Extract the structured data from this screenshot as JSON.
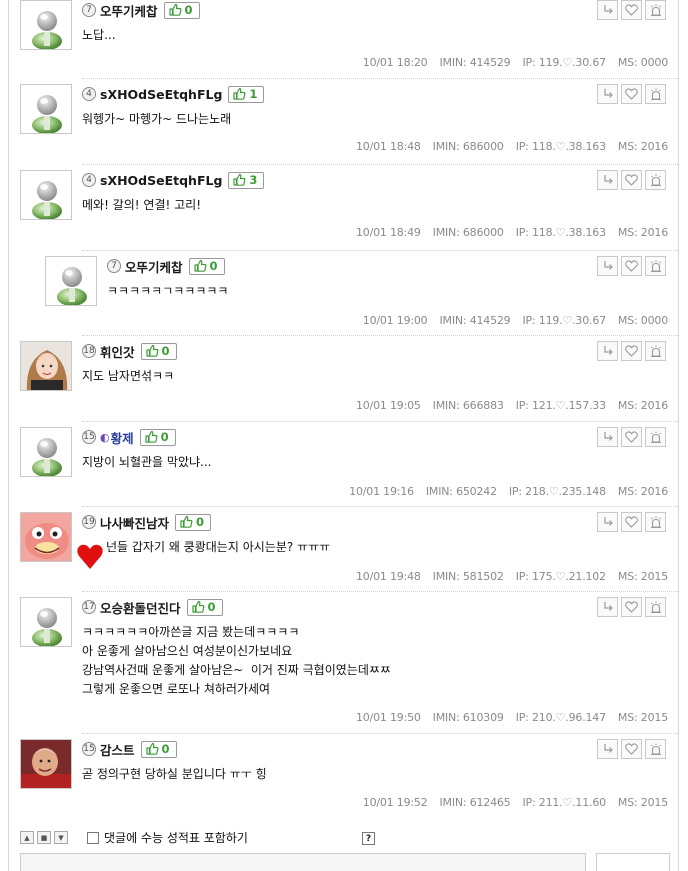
{
  "comments": [
    {
      "level": "7",
      "nick": "오뚜기케찹",
      "likes": "0",
      "lines": [
        "노답..."
      ],
      "date": "10/01 18:20",
      "imin": "IMIN: 414529",
      "ip": "IP: 119.♡.30.67",
      "ms": "MS: 0000",
      "avatar": "default"
    },
    {
      "level": "4",
      "nick": "sXHOdSeEtqhFLg",
      "likes": "1",
      "lines": [
        "워헹가~ 마헹가~ 드나는노래"
      ],
      "date": "10/01 18:48",
      "imin": "IMIN: 686000",
      "ip": "IP: 118.♡.38.163",
      "ms": "MS: 2016",
      "avatar": "default"
    },
    {
      "level": "4",
      "nick": "sXHOdSeEtqhFLg",
      "likes": "3",
      "lines": [
        "메와! 갈의! 연결! 고리!"
      ],
      "date": "10/01 18:49",
      "imin": "IMIN: 686000",
      "ip": "IP: 118.♡.38.163",
      "ms": "MS: 2016",
      "avatar": "default"
    },
    {
      "level": "7",
      "nick": "오뚜기케찹",
      "likes": "0",
      "lines": [
        "ㅋㅋㅋㅋㅋㄱㅋㅋㅋㅋㅋ"
      ],
      "date": "10/01 19:00",
      "imin": "IMIN: 414529",
      "ip": "IP: 119.♡.30.67",
      "ms": "MS: 0000",
      "avatar": "default",
      "reply": true
    },
    {
      "level": "18",
      "nick": "휘인갓",
      "likes": "0",
      "lines": [
        "지도 남자면섞ㅋㅋ"
      ],
      "date": "10/01 19:05",
      "imin": "IMIN: 666883",
      "ip": "IP: 121.♡.157.33",
      "ms": "MS: 2016",
      "avatar": "girl"
    },
    {
      "level": "15",
      "nick": "황제",
      "likes": "0",
      "lines": [
        "지방이 뇌혈관을 막았냐..."
      ],
      "date": "10/01 19:16",
      "imin": "IMIN: 650242",
      "ip": "IP: 218.♡.235.148",
      "ms": "MS: 2016",
      "avatar": "default",
      "badge": true
    },
    {
      "level": "19",
      "nick": "나사빠진남자",
      "likes": "0",
      "lines": [
        "넌들 갑자기 왜 쿵쾅대는지 아시는분? ㅠㅠㅠ"
      ],
      "date": "10/01 19:48",
      "imin": "IMIN: 581502",
      "ip": "IP: 175.♡.21.102",
      "ms": "MS: 2015",
      "avatar": "pink",
      "heart": true
    },
    {
      "level": "17",
      "nick": "오승환돌던진다",
      "likes": "0",
      "lines": [
        "ㅋㅋㅋㅋㅋㅋ아까쓴글 지금 봤는데ㅋㅋㅋㅋ",
        "아 운좋게 살아남으신 여성분이신가보네요",
        "강남역사건때 운좋게 살아남은~  이거 진짜 극협이였는데ㅉㅉ",
        "그렇게 운좋으면 로또나 쳐하러가세여"
      ],
      "date": "10/01 19:50",
      "imin": "IMIN: 610309",
      "ip": "IP: 210.♡.96.147",
      "ms": "MS: 2015",
      "avatar": "default"
    },
    {
      "level": "15",
      "nick": "감스트",
      "likes": "0",
      "lines": [
        "곧 정의구현 당하실 분입니다 ㅠㅜ 힝"
      ],
      "date": "10/01 19:52",
      "imin": "IMIN: 612465",
      "ip": "IP: 211.♡.11.60",
      "ms": "MS: 2015",
      "avatar": "man"
    }
  ],
  "footer": {
    "include_label": "댓글에 수능 성적표 포함하기",
    "help": "?"
  },
  "icons": {
    "reply": "reply-arrow-icon",
    "like": "heart-icon",
    "report": "siren-icon",
    "thumb": "thumbs-up-icon"
  },
  "colors": {
    "like_count": "#3d9b36",
    "nick_link": "#2b3f9a",
    "meta": "#8a8a8a"
  }
}
